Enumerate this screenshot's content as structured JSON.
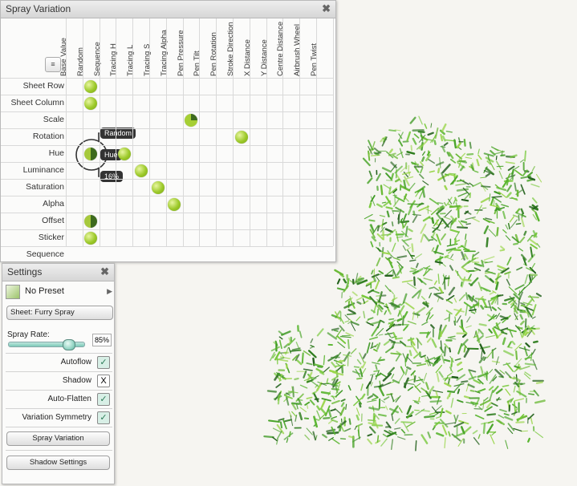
{
  "spray_panel": {
    "title": "Spray Variation",
    "columns": [
      "Base Value",
      "Random",
      "Sequence",
      "Tracing H",
      "Tracing L",
      "Tracing S",
      "Tracing Alpha",
      "Pen Pressure",
      "Pen Tilt",
      "Pen Rotation",
      "Stroke Direction",
      "X Distance",
      "Y Distance",
      "Centre Distance",
      "Airbrush Wheel",
      "Pen Twist"
    ],
    "rows": [
      "Sheet Row",
      "Sheet Column",
      "Scale",
      "Rotation",
      "Hue",
      "Luminance",
      "Saturation",
      "Alpha",
      "Offset",
      "Sticker Sequence"
    ],
    "assignments": [
      {
        "row": 0,
        "col": 1,
        "style": "plain"
      },
      {
        "row": 1,
        "col": 1,
        "style": "plain"
      },
      {
        "row": 2,
        "col": 7,
        "style": "split"
      },
      {
        "row": 3,
        "col": 10,
        "style": "plain"
      },
      {
        "row": 4,
        "col": 1,
        "style": "dark"
      },
      {
        "row": 4,
        "col": 3,
        "style": "plain"
      },
      {
        "row": 5,
        "col": 4,
        "style": "plain"
      },
      {
        "row": 6,
        "col": 5,
        "style": "plain"
      },
      {
        "row": 7,
        "col": 6,
        "style": "plain"
      },
      {
        "row": 8,
        "col": 1,
        "style": "dark"
      },
      {
        "row": 9,
        "col": 1,
        "style": "plain"
      }
    ],
    "popup": {
      "top": "Random",
      "middle": "Hue",
      "bottom": "16%"
    },
    "sort_icon": "sort-icon"
  },
  "settings_panel": {
    "title": "Settings",
    "preset": "No Preset",
    "sheet_button": "Sheet: Furry Spray",
    "spray_rate_label": "Spray Rate:",
    "spray_rate_value": "85%",
    "spray_rate_fraction": 0.85,
    "toggles": [
      {
        "label": "Autoflow",
        "mark": "✓",
        "on": true
      },
      {
        "label": "Shadow",
        "mark": "X",
        "on": false
      },
      {
        "label": "Auto-Flatten",
        "mark": "✓",
        "on": true
      },
      {
        "label": "Variation Symmetry",
        "mark": "✓",
        "on": true
      }
    ],
    "spray_variation_button": "Spray Variation",
    "shadow_settings_button": "Shadow Settings"
  },
  "icons": {
    "close": "close-icon",
    "brush": "brush-icon",
    "arrow": "triangle-right-icon"
  },
  "colors": {
    "dot": "#9cc929",
    "dark": "#3d6a1e",
    "accent": "#7ccab8"
  }
}
